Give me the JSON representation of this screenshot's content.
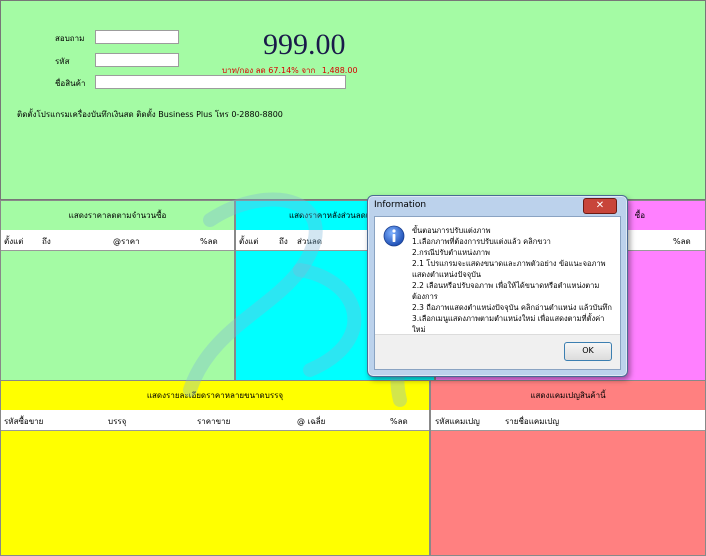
{
  "top": {
    "labels": {
      "member": "สอบถาม",
      "code": "รหัส",
      "product_name": "ชื่อสินค้า"
    },
    "price": "999.00",
    "discount_text": "บาท/กอง ลด 67.14% จาก",
    "original_price": "1,488.00",
    "contact": "ติดตั้งโปรแกรมเครื่องบันทึกเงินสด ติดตั้ง Business Plus โทร 0-2880-8800"
  },
  "panels": {
    "qty_price": {
      "title": "แสดงราคาลดตามจำนวนซื้อ",
      "columns": [
        "ตั้งแต่",
        "ถึง",
        "@ราคา",
        "%ลด"
      ]
    },
    "after_discount": {
      "title": "แสดงราคาหลังส่วนลดแล้ว",
      "columns": [
        "ตั้งแต่",
        "ถึง",
        "ส่วนลด"
      ]
    },
    "right_pink": {
      "title": "ซื้อ",
      "columns": [
        "%ลด"
      ]
    },
    "package_price": {
      "title": "แสดงรายละเอียดราคาหลายขนาดบรรจุ",
      "columns": [
        "รหัสซื้อขาย",
        "บรรจุ",
        "ราคาขาย",
        "@ เฉลี่ย",
        "%ลด"
      ]
    },
    "bundle": {
      "title": "แสดงแคมเปญสินค้านี้",
      "columns": [
        "รหัสแคมเปญ",
        "รายชื่อแคมเปญ"
      ]
    }
  },
  "dialog": {
    "title": "Information",
    "close_label": "✕",
    "lines": [
      "ขั้นตอนการปรับแต่งภาพ",
      "1.เลือกภาพที่ต้องการปรับแต่งแล้ว คลิกขวา",
      "2.กรณีปรับตำแหน่งภาพ",
      "2.1 โปรแกรมจะแสดงขนาดและภาพตัวอย่าง ข้อแนะจอภาพ แสดงตำแหน่งปัจจุบัน",
      "2.2 เลือนหรือปรับจอภาพ เพื่อให้ได้ขนาดหรือตำแหน่งตามต้องการ",
      "2.3 ถือภาพแสดงตำแหน่งปัจจุบัน คลิกอ่านตำแหน่ง แล้วบันทึก",
      "3.เลือกเมนูแสดงภาพตามตำแหน่งใหม่ เพื่อแสดงตามที่ตั้งค่าใหม่"
    ],
    "ok_label": "OK"
  },
  "colors": {
    "green": "#a4fba4",
    "cyan": "#00ffff",
    "magenta": "#ff80ff",
    "yellow": "#ffff00",
    "salmon": "#ff8080"
  },
  "icons": {
    "info": "info-icon",
    "close": "close-icon"
  }
}
